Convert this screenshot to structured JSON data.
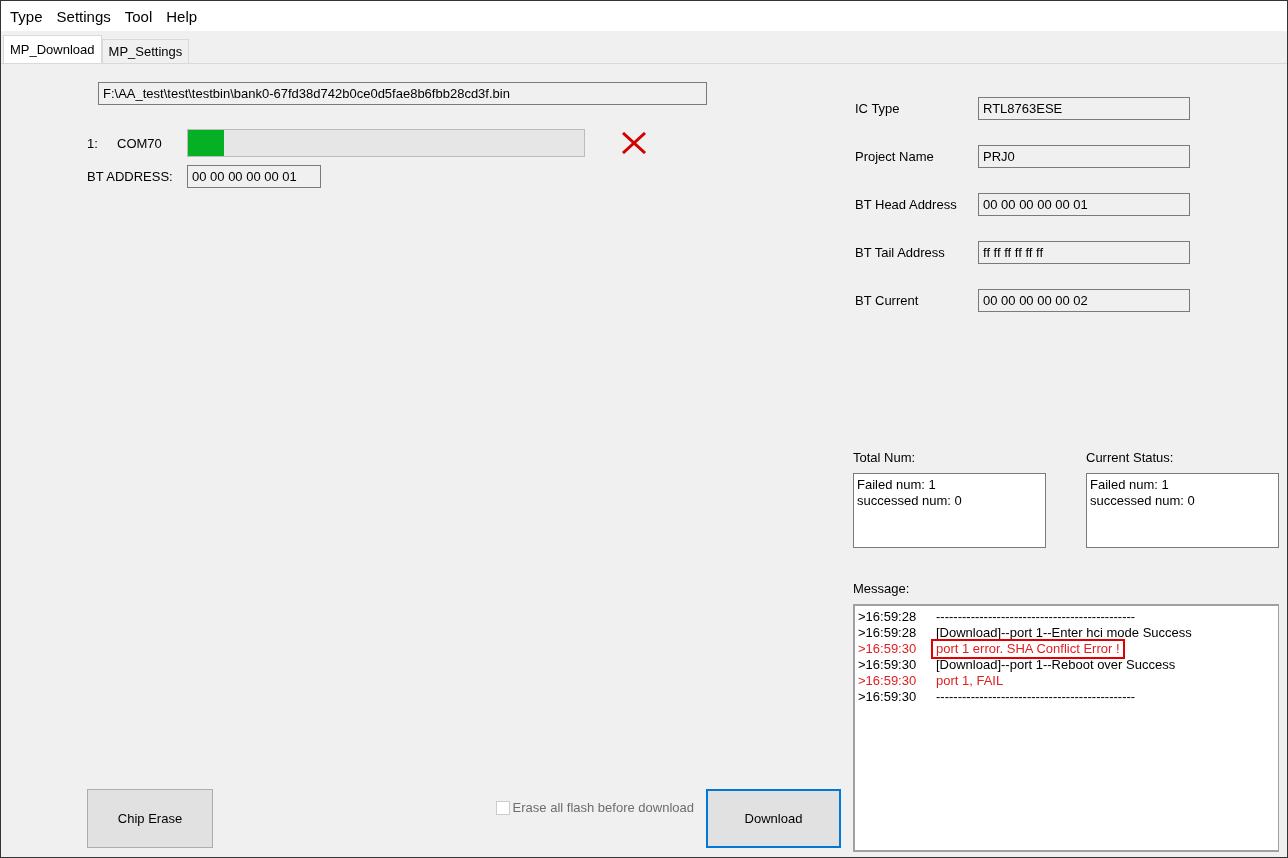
{
  "menu": [
    "Type",
    "Settings",
    "Tool",
    "Help"
  ],
  "tabs": [
    {
      "label": "MP_Download",
      "selected": true
    },
    {
      "label": "MP_Settings",
      "selected": false
    }
  ],
  "file_path": "F:\\AA_test\\test\\testbin\\bank0-67fd38d742b0ce0d5fae8b6fbb28cd3f.bin",
  "ports": [
    {
      "index": "1:",
      "name": "COM70",
      "level": 0.09,
      "failed": true,
      "bt_address_label": "BT ADDRESS:",
      "bt_address": "00 00 00 00 00 01"
    }
  ],
  "info_fields": [
    {
      "label": "IC Type",
      "value": "RTL8763ESE"
    },
    {
      "label": "Project Name",
      "value": "PRJ0"
    },
    {
      "label": "BT Head Address",
      "value": "00 00 00 00 00 01"
    },
    {
      "label": "BT Tail Address",
      "value": "ff ff ff ff ff ff"
    },
    {
      "label": "BT Current",
      "value": "00 00 00 00 00 02"
    }
  ],
  "counters": [
    {
      "label": "Total Num:",
      "lines": [
        "Failed num: 1",
        "successed num: 0"
      ]
    },
    {
      "label": "Current Status:",
      "lines": [
        "Failed num: 1",
        "successed num: 0"
      ]
    }
  ],
  "message": {
    "label": "Message:",
    "lines": [
      {
        "time": ">16:59:28",
        "text": "----------------------------------------------",
        "kind": "info",
        "highlighted": false
      },
      {
        "time": ">16:59:28",
        "text": "[Download]--port 1--Enter hci mode Success",
        "kind": "info",
        "highlighted": false
      },
      {
        "time": ">16:59:30",
        "text": "port 1 error. SHA Conflict Error !",
        "kind": "error",
        "highlighted": true
      },
      {
        "time": ">16:59:30",
        "text": "[Download]--port 1--Reboot over Success",
        "kind": "info",
        "highlighted": false
      },
      {
        "time": ">16:59:30",
        "text": "port 1, FAIL",
        "kind": "error",
        "highlighted": false
      },
      {
        "time": ">16:59:30",
        "text": "----------------------------------------------",
        "kind": "info",
        "highlighted": false
      }
    ]
  },
  "erase_option": {
    "label": "Erase all flash before download",
    "checked": false,
    "disabled": true
  },
  "buttons": [
    {
      "label": "Chip Erase",
      "focused": false
    },
    {
      "label": "Download",
      "focused": true
    }
  ]
}
